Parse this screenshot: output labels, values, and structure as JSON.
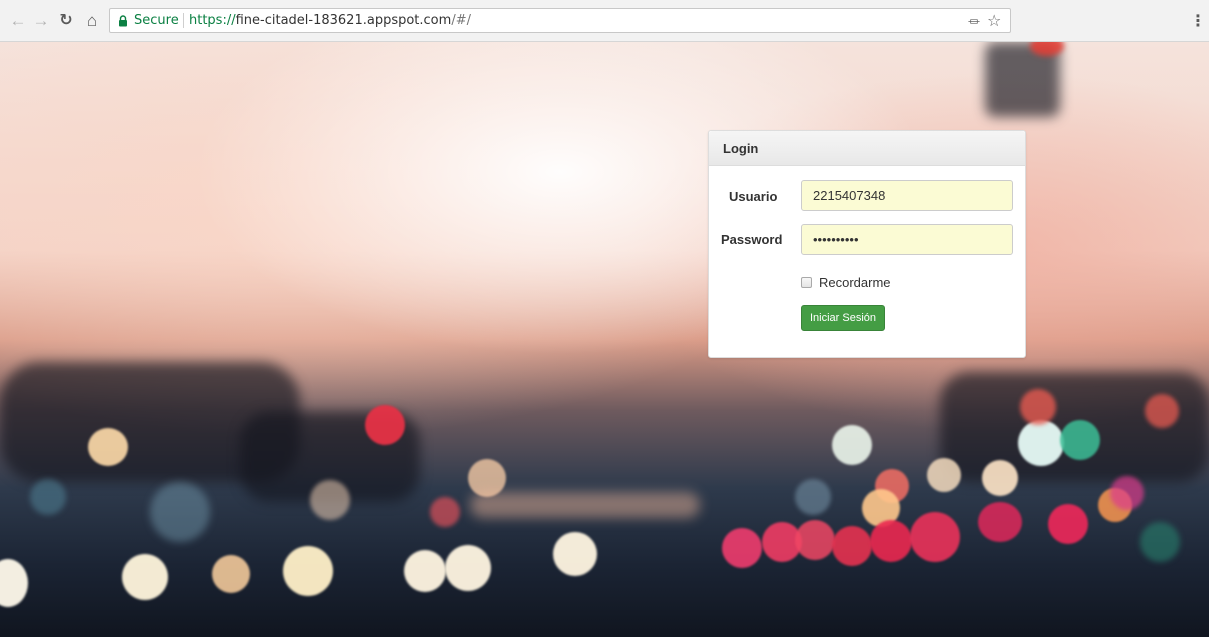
{
  "browser": {
    "back_icon": "arrow-left-icon",
    "forward_icon": "arrow-right-icon",
    "reload_icon": "reload-icon",
    "home_icon": "home-icon",
    "secure_label": "Secure",
    "url_scheme": "https://",
    "url_host": "fine-citadel-183621.appspot.com",
    "url_path": "/#/",
    "secure_color": "#0b8043"
  },
  "login": {
    "heading": "Login",
    "username_label": "Usuario",
    "username_value": "2215407348",
    "password_label": "Password",
    "password_value": "••••••••••",
    "remember_label": "Recordarme",
    "remember_checked": false,
    "submit_label": "Iniciar Sesión",
    "button_color": "#449d44"
  }
}
